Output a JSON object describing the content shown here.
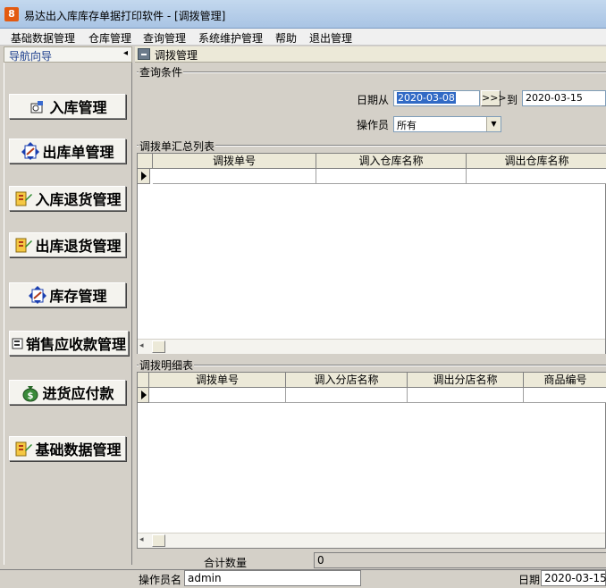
{
  "window": {
    "app_icon_text": "8",
    "title": "易达出入库库存单据打印软件  - [调拨管理]"
  },
  "menu": [
    "基础数据管理",
    "仓库管理",
    "查询管理",
    "系统维护管理",
    "帮助",
    "退出管理"
  ],
  "nav": {
    "header": "导航向导",
    "collapse_arrow": "◂",
    "items": [
      {
        "label": "入库管理",
        "icon": "stock-in-icon"
      },
      {
        "label": "出库单管理",
        "icon": "stock-out-icon"
      },
      {
        "label": "入库退货管理",
        "icon": "return-in-icon"
      },
      {
        "label": "出库退货管理",
        "icon": "return-out-icon"
      },
      {
        "label": "库存管理",
        "icon": "inventory-icon"
      },
      {
        "label": "销售应收款管理",
        "icon": "receivable-icon"
      },
      {
        "label": "进货应付款",
        "icon": "money-bag-icon"
      },
      {
        "label": "基础数据管理",
        "icon": "base-data-icon"
      }
    ]
  },
  "main": {
    "tab_label": "调拨管理",
    "query": {
      "group_title": "查询条件",
      "date_from_label": "日期从",
      "date_from_value": "2020-03-08",
      "date_picker_button": ">>>",
      "date_to_label": "到",
      "date_to_value": "2020-03-15",
      "operator_label": "操作员",
      "operator_value": "所有"
    },
    "summary": {
      "group_title": "调拨单汇总列表",
      "columns": [
        "调拨单号",
        "调入仓库名称",
        "调出仓库名称"
      ]
    },
    "detail": {
      "group_title": "调拨明细表",
      "columns": [
        "调拨单号",
        "调入分店名称",
        "调出分店名称",
        "商品编号"
      ]
    },
    "total_label": "合计数量",
    "total_value": "0"
  },
  "status": {
    "operator_label": "操作员名",
    "operator_value": "admin",
    "date_label": "日期",
    "date_value": "2020-03-15"
  },
  "colors": {
    "selection": "#316ac5",
    "window_bg": "#d4d0c8",
    "nav_header_text": "#1a3c8c"
  }
}
